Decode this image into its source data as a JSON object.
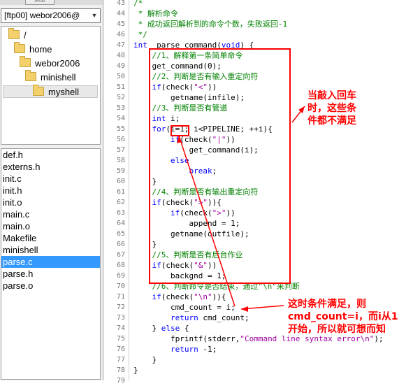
{
  "left_panel": {
    "tab_label": "浏览",
    "site_select": "[ftp00] webor2006@",
    "tree": [
      {
        "label": "/",
        "indent": 0
      },
      {
        "label": "home",
        "indent": 1
      },
      {
        "label": "webor2006",
        "indent": 2
      },
      {
        "label": "minishell",
        "indent": 3
      },
      {
        "label": "myshell",
        "indent": 4,
        "selected": true
      }
    ],
    "files": [
      "def.h",
      "externs.h",
      "init.c",
      "init.h",
      "init.o",
      "main.c",
      "main.o",
      "Makefile",
      "minishell",
      "parse.c",
      "parse.h",
      "parse.o"
    ],
    "selected_file": "parse.c"
  },
  "editor": {
    "lines": [
      {
        "n": "43",
        "segs": [
          [
            "cm",
            "/*"
          ]
        ]
      },
      {
        "n": "44",
        "segs": [
          [
            "cm",
            " * 解析命令"
          ]
        ]
      },
      {
        "n": "45",
        "segs": [
          [
            "cm",
            " * 成功返回解析到的命令个数，失败返回-1"
          ]
        ]
      },
      {
        "n": "46",
        "segs": [
          [
            "cm",
            " */"
          ]
        ]
      },
      {
        "n": "47",
        "segs": [
          [
            "kw",
            "int"
          ],
          [
            "",
            "  parse_command("
          ],
          [
            "kw",
            "void"
          ],
          [
            "",
            ") {"
          ]
        ]
      },
      {
        "n": "48",
        "segs": [
          [
            "",
            "    "
          ],
          [
            "cm",
            "//1、解释第一条简单命令"
          ]
        ]
      },
      {
        "n": "49",
        "segs": [
          [
            "",
            "    get_command(0);"
          ]
        ]
      },
      {
        "n": "50",
        "segs": [
          [
            "",
            "    "
          ],
          [
            "cm",
            "//2、判断是否有输入重定向符"
          ]
        ]
      },
      {
        "n": "51",
        "segs": [
          [
            "",
            "    "
          ],
          [
            "kw",
            "if"
          ],
          [
            "",
            "(check("
          ],
          [
            "str",
            "\"<\""
          ],
          [
            "",
            "))"
          ]
        ]
      },
      {
        "n": "52",
        "segs": [
          [
            "",
            "        getname(infile);"
          ]
        ]
      },
      {
        "n": "53",
        "segs": [
          [
            "",
            "    "
          ],
          [
            "cm",
            "//3、判断是否有管道"
          ]
        ]
      },
      {
        "n": "54",
        "segs": [
          [
            "",
            "    "
          ],
          [
            "kw",
            "int"
          ],
          [
            "",
            " i;"
          ]
        ]
      },
      {
        "n": "55",
        "segs": [
          [
            "",
            "    "
          ],
          [
            "kw",
            "for"
          ],
          [
            "",
            "(i=1; i<PIPELINE; ++i){"
          ]
        ]
      },
      {
        "n": "56",
        "segs": [
          [
            "",
            "        "
          ],
          [
            "kw",
            "if"
          ],
          [
            "",
            "(check("
          ],
          [
            "str",
            "\"|\""
          ],
          [
            "",
            "))"
          ]
        ]
      },
      {
        "n": "57",
        "segs": [
          [
            "",
            "            get_command(i);"
          ]
        ]
      },
      {
        "n": "58",
        "segs": [
          [
            "",
            "        "
          ],
          [
            "kw",
            "else"
          ]
        ]
      },
      {
        "n": "59",
        "segs": [
          [
            "",
            "            "
          ],
          [
            "kw",
            "break"
          ],
          [
            "",
            ";"
          ]
        ]
      },
      {
        "n": "60",
        "segs": [
          [
            "",
            "    }"
          ]
        ]
      },
      {
        "n": "61",
        "segs": [
          [
            "",
            "    "
          ],
          [
            "cm",
            "//4、判断是否有输出重定向符"
          ]
        ]
      },
      {
        "n": "62",
        "segs": [
          [
            "",
            "    "
          ],
          [
            "kw",
            "if"
          ],
          [
            "",
            "(check("
          ],
          [
            "str",
            "\">\""
          ],
          [
            "",
            "))"
          ],
          [
            "",
            "{"
          ]
        ]
      },
      {
        "n": "63",
        "segs": [
          [
            "",
            "        "
          ],
          [
            "kw",
            "if"
          ],
          [
            "",
            "(check("
          ],
          [
            "str",
            "\">\""
          ],
          [
            "",
            "))"
          ]
        ]
      },
      {
        "n": "64",
        "segs": [
          [
            "",
            "            append = 1;"
          ]
        ]
      },
      {
        "n": "65",
        "segs": [
          [
            "",
            "        getname(outfile);"
          ]
        ]
      },
      {
        "n": "66",
        "segs": [
          [
            "",
            "    }"
          ]
        ]
      },
      {
        "n": "67",
        "segs": [
          [
            "",
            "    "
          ],
          [
            "cm",
            "//5、判断是否有后台作业"
          ]
        ]
      },
      {
        "n": "68",
        "segs": [
          [
            "",
            "    "
          ],
          [
            "kw",
            "if"
          ],
          [
            "",
            "(check("
          ],
          [
            "str",
            "\"&\""
          ],
          [
            "",
            "))"
          ]
        ]
      },
      {
        "n": "69",
        "segs": [
          [
            "",
            "        backgnd = 1;"
          ]
        ]
      },
      {
        "n": "70",
        "segs": [
          [
            "",
            "    "
          ],
          [
            "cm",
            "//6、判断命令是否结束，通过\"\\n\"来判断"
          ]
        ]
      },
      {
        "n": "71",
        "segs": [
          [
            "",
            "    "
          ],
          [
            "kw",
            "if"
          ],
          [
            "",
            "(check("
          ],
          [
            "str",
            "\"\\n\""
          ],
          [
            "",
            "))"
          ],
          [
            "",
            "{"
          ]
        ]
      },
      {
        "n": "72",
        "segs": [
          [
            "",
            "        cmd_count = i;"
          ]
        ]
      },
      {
        "n": "73",
        "segs": [
          [
            "",
            "        "
          ],
          [
            "kw",
            "return"
          ],
          [
            "",
            " cmd_count;"
          ]
        ]
      },
      {
        "n": "74",
        "segs": [
          [
            "",
            "    } "
          ],
          [
            "kw",
            "else"
          ],
          [
            "",
            " {"
          ]
        ]
      },
      {
        "n": "75",
        "segs": [
          [
            "",
            "        fprintf(stderr,"
          ],
          [
            "str",
            "\"Command line syntax error\\n\""
          ],
          [
            "",
            ");"
          ]
        ]
      },
      {
        "n": "76",
        "segs": [
          [
            "",
            "        "
          ],
          [
            "kw",
            "return"
          ],
          [
            "",
            " -1;"
          ]
        ]
      },
      {
        "n": "77",
        "segs": [
          [
            "",
            "    }"
          ]
        ]
      },
      {
        "n": "78",
        "segs": [
          [
            "",
            "}"
          ]
        ]
      },
      {
        "n": "79",
        "segs": [
          [
            "",
            ""
          ]
        ]
      }
    ]
  },
  "annotations": {
    "note1": "当敲入回车\n时，这些条\n件都不满足",
    "note2": "这时条件满足，则\ncmd_count=i，而i从1\n开始，所以就可想而知"
  },
  "colors": {
    "annotation": "#ff0000",
    "selection": "#3399ff",
    "keyword": "#0000ff",
    "comment": "#008000",
    "string": "#a000a0"
  }
}
